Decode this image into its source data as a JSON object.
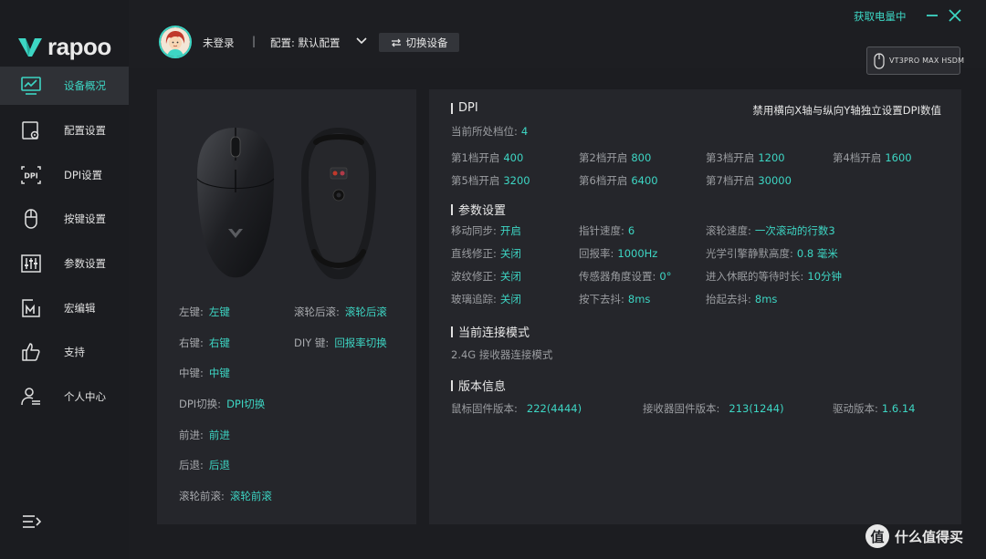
{
  "app": {
    "logo_text": "rapoo",
    "battery_status": "获取电量中"
  },
  "sidebar": {
    "items": [
      {
        "label": "设备概况",
        "icon": "monitor-chart-icon"
      },
      {
        "label": "配置设置",
        "icon": "config-gear-icon"
      },
      {
        "label": "DPI设置",
        "icon": "dpi-icon"
      },
      {
        "label": "按键设置",
        "icon": "mouse-icon"
      },
      {
        "label": "参数设置",
        "icon": "sliders-icon"
      },
      {
        "label": "宏编辑",
        "icon": "macro-icon"
      },
      {
        "label": "支持",
        "icon": "thumbs-up-icon"
      },
      {
        "label": "个人中心",
        "icon": "user-icon"
      }
    ],
    "active_index": 0
  },
  "header": {
    "login_text": "未登录",
    "separator": "|",
    "profile_label": "配置: 默认配置",
    "switch_device_label": "切换设备",
    "device_name": "VT3PRO MAX HSDM"
  },
  "buttons": {
    "left_col": [
      {
        "key": "左键:",
        "value": "左键"
      },
      {
        "key": "右键:",
        "value": "右键"
      },
      {
        "key": "中键:",
        "value": "中键"
      },
      {
        "key": "DPI切换:",
        "value": "DPI切换"
      },
      {
        "key": "前进:",
        "value": "前进"
      },
      {
        "key": "后退:",
        "value": "后退"
      },
      {
        "key": "滚轮前滚:",
        "value": "滚轮前滚"
      }
    ],
    "right_col": [
      {
        "key": "滚轮后滚:",
        "value": "滚轮后滚"
      },
      {
        "key": "DIY 键:",
        "value": "回报率切换"
      }
    ]
  },
  "dpi": {
    "title": "DPI",
    "independent_xy_text": "禁用横向X轴与纵向Y轴独立设置DPI数值",
    "current_level_label": "当前所处档位:",
    "current_level": "4",
    "levels": [
      {
        "label": "第1档开启",
        "value": "400"
      },
      {
        "label": "第2档开启",
        "value": "800"
      },
      {
        "label": "第3档开启",
        "value": "1200"
      },
      {
        "label": "第4档开启",
        "value": "1600"
      },
      {
        "label": "第5档开启",
        "value": "3200"
      },
      {
        "label": "第6档开启",
        "value": "6400"
      },
      {
        "label": "第7档开启",
        "value": "30000"
      }
    ]
  },
  "params": {
    "title": "参数设置",
    "items": [
      {
        "key": "移动同步:",
        "value": "开启"
      },
      {
        "key": "指针速度:",
        "value": "6"
      },
      {
        "key": "滚轮速度:",
        "value": "一次滚动的行数3"
      },
      {
        "key": "直线修正:",
        "value": "关闭"
      },
      {
        "key": "回报率:",
        "value": "1000Hz"
      },
      {
        "key": "光学引擎静默高度:",
        "value": "0.8 毫米"
      },
      {
        "key": "波纹修正:",
        "value": "关闭"
      },
      {
        "key": "传感器角度设置:",
        "value": "0°"
      },
      {
        "key": "进入休眠的等待时长:",
        "value": "10分钟"
      },
      {
        "key": "玻璃追踪:",
        "value": "关闭"
      },
      {
        "key": "按下去抖:",
        "value": "8ms"
      },
      {
        "key": "抬起去抖:",
        "value": "8ms"
      }
    ]
  },
  "connection": {
    "title": "当前连接模式",
    "mode": "2.4G 接收器连接模式"
  },
  "version": {
    "title": "版本信息",
    "items": [
      {
        "key": "鼠标固件版本:",
        "value": "222(4444)"
      },
      {
        "key": "接收器固件版本:",
        "value": "213(1244)"
      },
      {
        "key": "驱动版本:",
        "value": "1.6.14"
      }
    ]
  },
  "watermark": {
    "glyph": "值",
    "text": "什么值得买"
  },
  "colors": {
    "accent": "#3dd6c4",
    "panel": "#25262b",
    "background": "#1c1d21"
  }
}
